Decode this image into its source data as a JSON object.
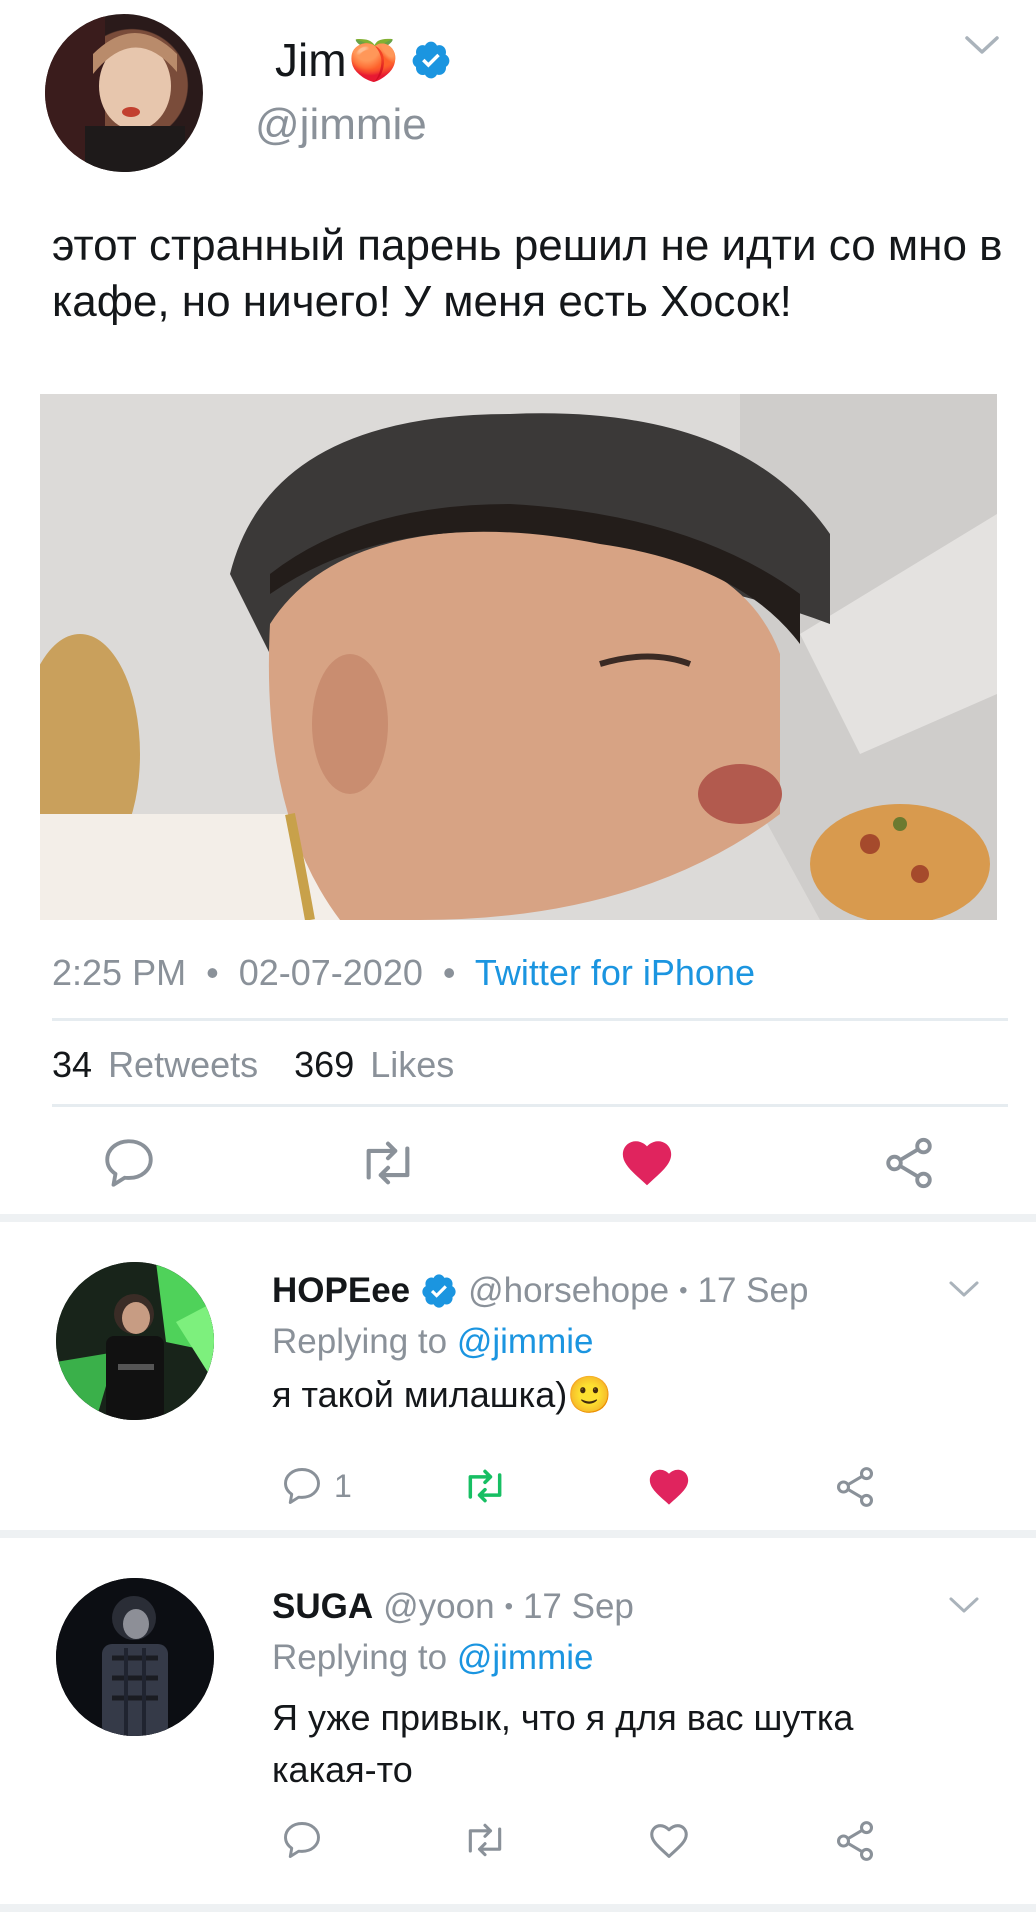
{
  "main_tweet": {
    "display_name": "Jim",
    "name_emoji": "🍑",
    "handle": "@jimmie",
    "text": "этот странный парень решил не идти со мно в кафе, но ничего! У меня есть Хосок!",
    "time": "2:25 PM",
    "dot1": "•",
    "date": "02-07-2020",
    "dot2": "•",
    "source": "Twitter for iPhone",
    "retweets_count": "34",
    "retweets_label": "Retweets",
    "likes_count": "369",
    "likes_label": "Likes"
  },
  "replies": [
    {
      "display_name": "HOPEee",
      "handle": "@horsehope",
      "dot": "•",
      "date": "17 Sep",
      "replying_prefix": "Replying to",
      "replying_handle": "@jimmie",
      "text": "я такой милашка)🙂",
      "reply_count": "1"
    },
    {
      "display_name": "SUGA",
      "handle": "@yoon",
      "dot": "•",
      "date": "17 Sep",
      "replying_prefix": "Replying to",
      "replying_handle": "@jimmie",
      "text_line1": "Я уже привык, что я для вас шутка",
      "text_line2": "какая-то"
    }
  ],
  "colors": {
    "accent": "#1b95e0",
    "like_red": "#e0245e",
    "retweet_green": "#17bf63",
    "icon_gray": "#8a9199",
    "divider": "#e6ecf0"
  }
}
